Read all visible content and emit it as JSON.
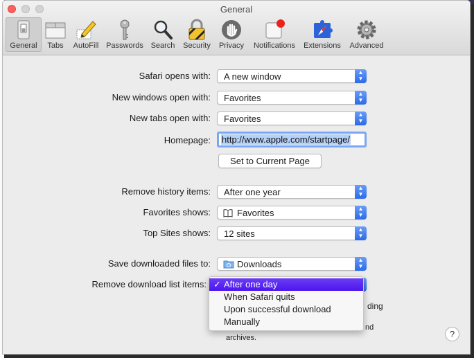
{
  "window": {
    "title": "General"
  },
  "toolbar": {
    "items": [
      {
        "label": "General",
        "icon": "general-switch-icon"
      },
      {
        "label": "Tabs",
        "icon": "tabs-icon"
      },
      {
        "label": "AutoFill",
        "icon": "autofill-pencil-icon"
      },
      {
        "label": "Passwords",
        "icon": "key-icon"
      },
      {
        "label": "Search",
        "icon": "magnifier-icon"
      },
      {
        "label": "Security",
        "icon": "lock-icon"
      },
      {
        "label": "Privacy",
        "icon": "hand-icon"
      },
      {
        "label": "Notifications",
        "icon": "notifications-icon"
      },
      {
        "label": "Extensions",
        "icon": "puzzle-compass-icon"
      },
      {
        "label": "Advanced",
        "icon": "gear-icon"
      }
    ],
    "active": "General"
  },
  "settings": {
    "safari_opens_label": "Safari opens with:",
    "safari_opens_value": "A new window",
    "new_windows_label": "New windows open with:",
    "new_windows_value": "Favorites",
    "new_tabs_label": "New tabs open with:",
    "new_tabs_value": "Favorites",
    "homepage_label": "Homepage:",
    "homepage_value": "http://www.apple.com/startpage/",
    "set_current_button": "Set to Current Page",
    "remove_history_label": "Remove history items:",
    "remove_history_value": "After one year",
    "favorites_shows_label": "Favorites shows:",
    "favorites_shows_value": "Favorites",
    "top_sites_label": "Top Sites shows:",
    "top_sites_value": "12 sites",
    "save_downloads_label": "Save downloaded files to:",
    "save_downloads_value": "Downloads",
    "remove_download_label": "Remove download list items:"
  },
  "menu": {
    "options": [
      "After one day",
      "When Safari quits",
      "Upon successful download",
      "Manually"
    ],
    "selected": "After one day"
  },
  "partial_text": {
    "ding": "ding",
    "nd": "nd",
    "archives": "archives."
  },
  "help_button": "?",
  "colors": {
    "selection": "#4b17ee",
    "popup_arrow": "#2b6be8",
    "close": "#fc605c"
  }
}
